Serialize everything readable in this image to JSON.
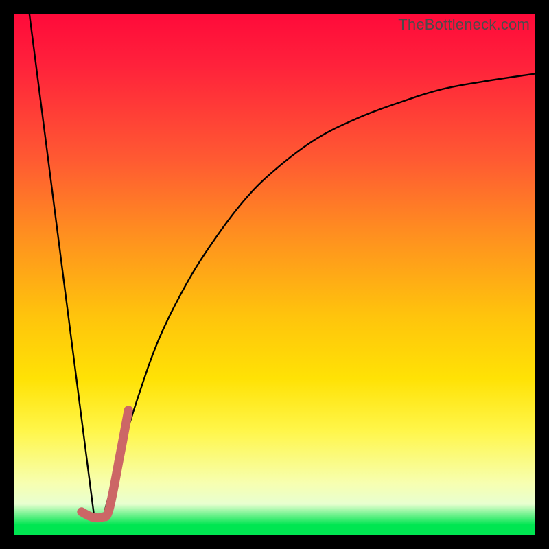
{
  "watermark": "TheBottleneck.com",
  "colors": {
    "curve_stroke": "#000000",
    "accent_stroke": "#cc6666",
    "frame_bg": "#000000"
  },
  "chart_data": {
    "type": "line",
    "title": "",
    "xlabel": "",
    "ylabel": "",
    "xlim": [
      0,
      100
    ],
    "ylim": [
      0,
      100
    ],
    "series": [
      {
        "name": "left-falling-line",
        "x": [
          3,
          15.5
        ],
        "values": [
          100,
          3
        ]
      },
      {
        "name": "right-rising-curve",
        "x": [
          17,
          20,
          24,
          28,
          33,
          38,
          44,
          50,
          58,
          66,
          74,
          82,
          90,
          100
        ],
        "values": [
          3,
          14,
          27,
          38,
          48,
          56,
          64,
          70,
          76,
          80,
          83,
          85.5,
          87,
          88.5
        ]
      },
      {
        "name": "accent-hook",
        "x": [
          13,
          15,
          17,
          18.3,
          20.3,
          22
        ],
        "values": [
          4.5,
          3.5,
          3.5,
          5,
          15,
          24
        ]
      }
    ],
    "annotations": []
  }
}
